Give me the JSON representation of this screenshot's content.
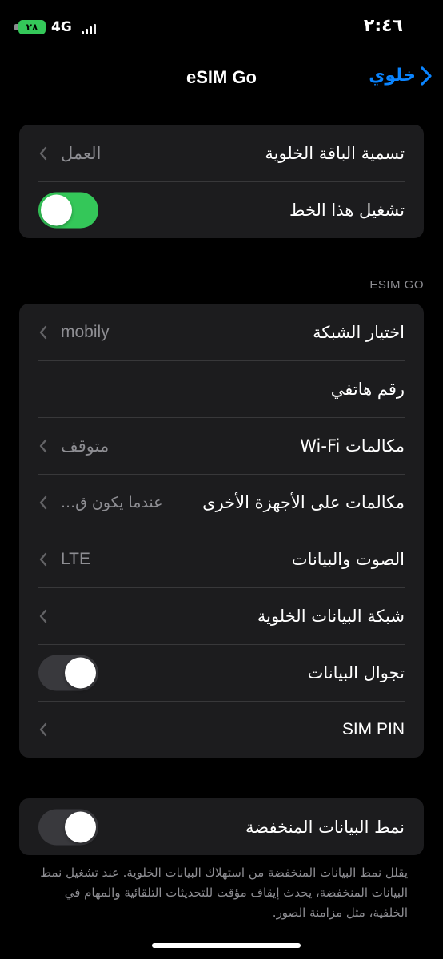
{
  "status_bar": {
    "battery": "٢٨",
    "network": "4G",
    "time": "٢:٤٦"
  },
  "nav": {
    "title": "eSIM Go",
    "back_label": "خلوي"
  },
  "group1": {
    "plan_label": {
      "label": "تسمية الباقة الخلوية",
      "value": "العمل"
    },
    "line_toggle": {
      "label": "تشغيل هذا الخط",
      "state": "on"
    }
  },
  "section_header": "ESIM GO",
  "group2": {
    "network_selection": {
      "label": "اختيار الشبكة",
      "value": "mobily"
    },
    "phone_number": {
      "label": "رقم هاتفي"
    },
    "wifi_calling": {
      "label": "مكالمات Wi-Fi",
      "value": "متوقف"
    },
    "other_devices": {
      "label": "مكالمات على الأجهزة الأخرى",
      "value": "عندما يكون ق..."
    },
    "voice_data": {
      "label": "الصوت والبيانات",
      "value": "LTE"
    },
    "cellular_data_network": {
      "label": "شبكة البيانات الخلوية"
    },
    "data_roaming": {
      "label": "تجوال البيانات",
      "state": "off"
    },
    "sim_pin": {
      "label": "SIM PIN"
    }
  },
  "group3": {
    "low_data_mode": {
      "label": "نمط البيانات المنخفضة",
      "state": "off"
    }
  },
  "footer_note": "يقلل نمط البيانات المنخفضة من استهلاك البيانات الخلوية. عند تشغيل نمط البيانات المنخفضة، يحدث إيقاف مؤقت للتحديثات التلقائية والمهام في الخلفية، مثل مزامنة الصور.",
  "colors": {
    "accent": "#0a84ff",
    "toggle_on": "#34c759",
    "toggle_off": "#39393d",
    "group_bg": "#1c1c1e",
    "secondary_text": "#8e8e93"
  },
  "icons": {
    "back": "chevron-right-icon",
    "disclosure": "chevron-left-icon"
  }
}
